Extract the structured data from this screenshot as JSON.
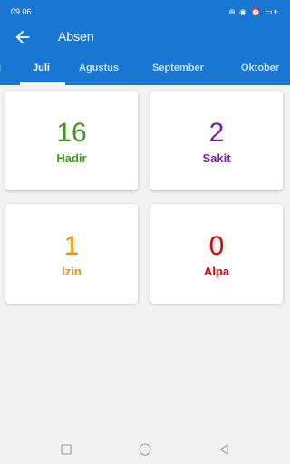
{
  "status_bar": {
    "time": "09.06",
    "icons_text": "⊕ ◉ ⏰ ▭+"
  },
  "app_bar": {
    "title": "Absen",
    "back_icon": "arrow-back-icon"
  },
  "tabs": [
    {
      "label": "i",
      "active": false
    },
    {
      "label": "Juli",
      "active": true
    },
    {
      "label": "Agustus",
      "active": false
    },
    {
      "label": "September",
      "active": false
    },
    {
      "label": "Oktober",
      "active": false
    }
  ],
  "cards": [
    {
      "value": "16",
      "label": "Hadir",
      "color": "#3f9a1c"
    },
    {
      "value": "2",
      "label": "Sakit",
      "color": "#7b1fa2"
    },
    {
      "value": "1",
      "label": "Izin",
      "color": "#f28c00"
    },
    {
      "value": "0",
      "label": "Alpa",
      "color": "#e00000"
    }
  ],
  "colors": {
    "primary": "#1877d2",
    "background": "#f2f2f2"
  }
}
